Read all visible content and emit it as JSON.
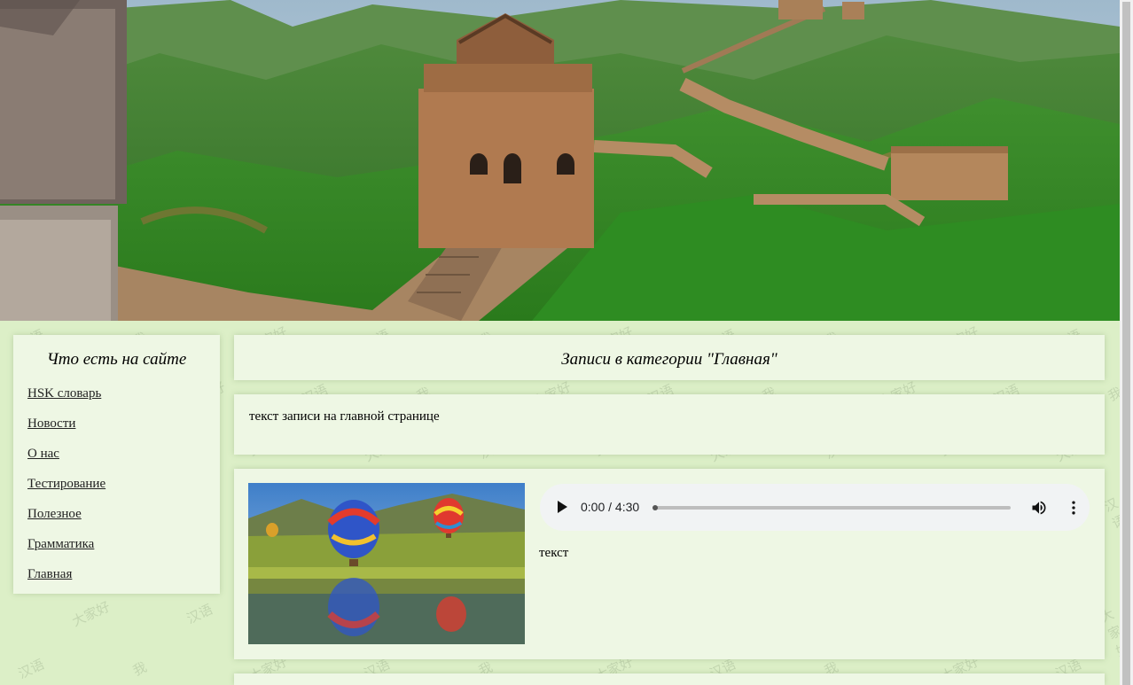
{
  "sidebar": {
    "title": "Что есть на сайте",
    "items": [
      {
        "label": "HSK словарь"
      },
      {
        "label": "Новости"
      },
      {
        "label": "О нас"
      },
      {
        "label": "Тестирование"
      },
      {
        "label": "Полезное"
      },
      {
        "label": "Грамматика"
      },
      {
        "label": "Главная"
      }
    ]
  },
  "main": {
    "heading": "Записи в категории \"Главная\"",
    "post_text": "текст записи на главной странице",
    "media": {
      "audio_time": "0:00 / 4:30",
      "caption": "текст"
    }
  },
  "background": {
    "glyphs": [
      "汉语",
      "我",
      "大家好"
    ]
  },
  "colors": {
    "page_bg": "#dcefc7",
    "panel_bg": "#eef7e4"
  },
  "icons": {
    "play": "play-icon",
    "volume": "volume-icon",
    "more": "more-vert-icon"
  }
}
